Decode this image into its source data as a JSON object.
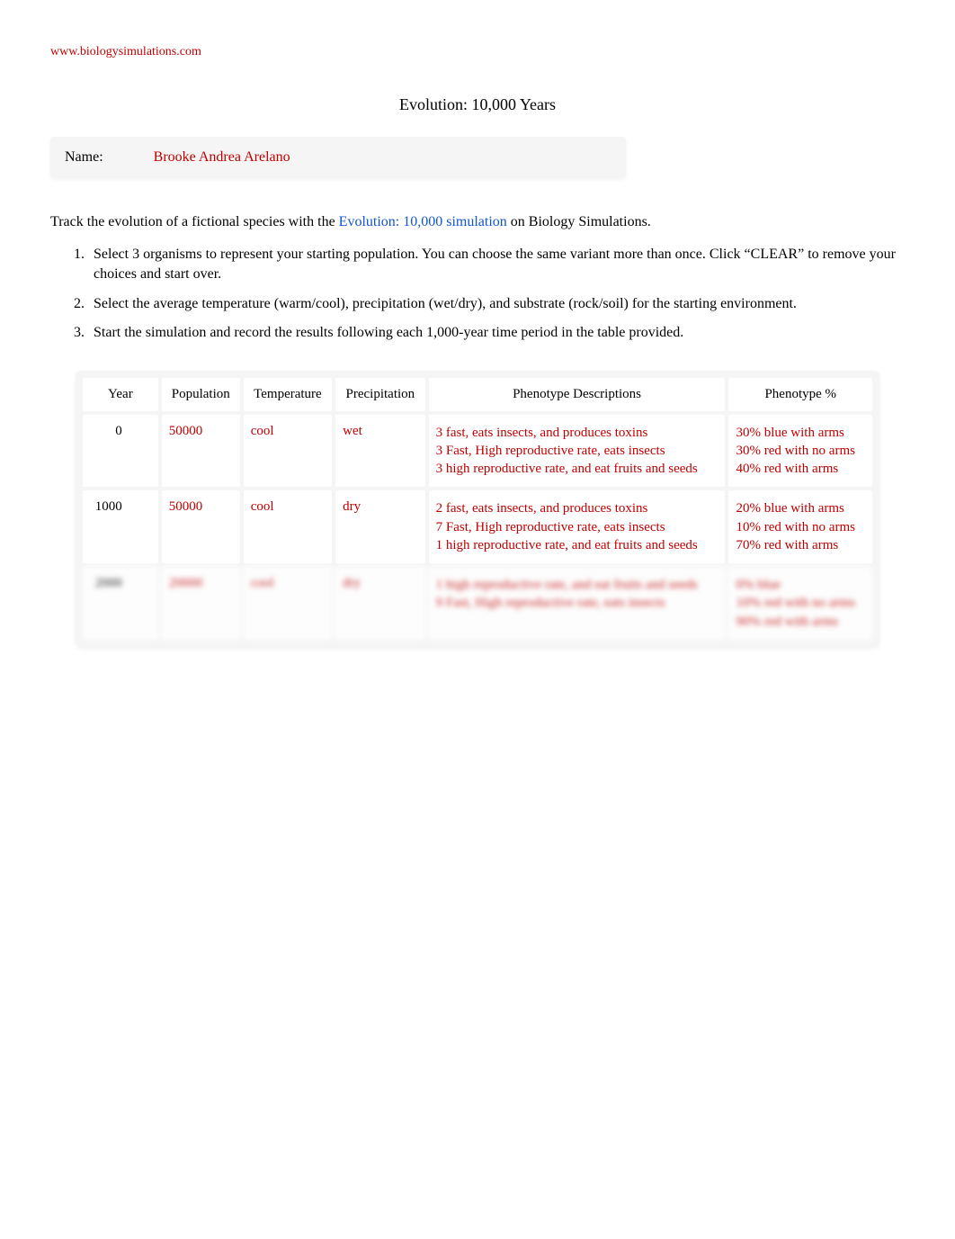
{
  "header": {
    "site_link": "www.biologysimulations.com",
    "title": "Evolution: 10,000 Years"
  },
  "name_field": {
    "label": "Name:",
    "value": "Brooke Andrea Arelano"
  },
  "intro": {
    "prefix": "Track the evolution of a fictional species with the ",
    "link_text": "Evolution: 10,000 simulation",
    "suffix": " on Biology Simulations."
  },
  "instructions": [
    "Select 3 organisms to represent your starting population. You can choose the same variant more than once. Click “CLEAR” to remove your choices and start over.",
    "Select the average temperature (warm/cool), precipitation (wet/dry), and substrate (rock/soil) for the starting environment.",
    "Start the simulation and record the results following each 1,000-year time period in the table provided."
  ],
  "table": {
    "headers": [
      "Year",
      "Population",
      "Temperature",
      "Precipitation",
      "Phenotype Descriptions",
      "Phenotype %"
    ],
    "rows": [
      {
        "year": "0",
        "population": "50000",
        "temperature": "cool",
        "precipitation": "wet",
        "phenotype_desc": "3 fast, eats insects, and produces toxins\n3 Fast, High reproductive rate, eats insects\n3 high reproductive rate, and eat fruits and seeds",
        "phenotype_pct": "30% blue with arms\n30% red with no arms\n40% red with arms"
      },
      {
        "year": "1000",
        "population": "50000",
        "temperature": "cool",
        "precipitation": "dry",
        "phenotype_desc": "2 fast, eats insects, and produces toxins\n7 Fast, High reproductive rate, eats insects\n1 high reproductive rate, and eat fruits and seeds",
        "phenotype_pct": "20% blue with arms\n10% red with no arms\n70% red with arms"
      },
      {
        "year": "2000",
        "population": "20000",
        "temperature": "cool",
        "precipitation": "dry",
        "phenotype_desc": "1 high reproductive rate, and eat fruits and seeds\n9 Fast, High reproductive rate, eats insects",
        "phenotype_pct": "0% blue\n10% red with no arms\n90% red with arms"
      }
    ]
  }
}
